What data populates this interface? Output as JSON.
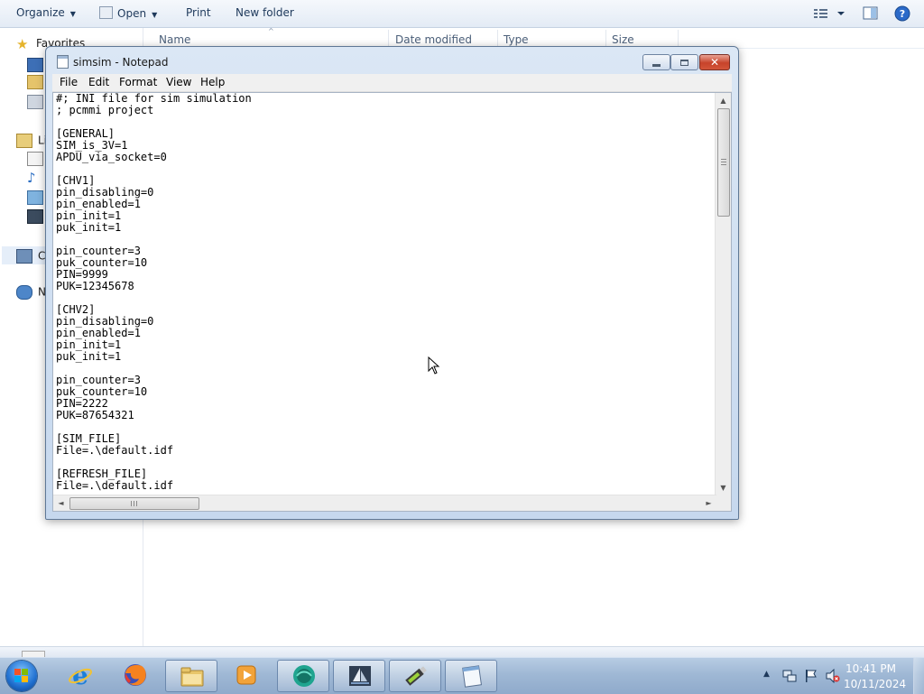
{
  "explorer": {
    "toolbar": {
      "organize_label": "Organize",
      "open_label": "Open",
      "print_label": "Print",
      "new_folder_label": "New folder"
    },
    "nav": {
      "favorites_label": "Favorites",
      "libraries_label": "Li",
      "computer_label": "C",
      "network_label": "N"
    },
    "columns": {
      "name": "Name",
      "date_modified": "Date modified",
      "type": "Type",
      "size": "Size"
    }
  },
  "notepad": {
    "title": "simsim - Notepad",
    "menu": {
      "file": "File",
      "edit": "Edit",
      "format": "Format",
      "view": "View",
      "help": "Help"
    },
    "content": "#; INI file for sim simulation\n; pcmmi project\n\n[GENERAL]\nSIM_is_3V=1\nAPDU_via_socket=0\n\n[CHV1]\npin_disabling=0\npin_enabled=1\npin_init=1\npuk_init=1\n\npin_counter=3\npuk_counter=10\nPIN=9999\nPUK=12345678\n\n[CHV2]\npin_disabling=0\npin_enabled=1\npin_init=1\npuk_init=1\n\npin_counter=3\npuk_counter=10\nPIN=2222\nPUK=87654321\n\n[SIM_FILE]\nFile=.\\default.idf\n\n[REFRESH_FILE]\nFile=.\\default.idf"
  },
  "taskbar": {
    "pinned": [
      "start-orb",
      "internet-explorer",
      "firefox",
      "windows-explorer",
      "media-player",
      "app-green-globe",
      "app-sailboat",
      "app-usb-stick",
      "notepad"
    ],
    "clock": {
      "time": "10:41 PM",
      "date": "10/11/2024"
    }
  },
  "colors": {
    "taskbar": "#9fb8d5",
    "window_frame": "#c6d8ee",
    "close_button": "#c7432a",
    "explorer_toolbar": "#e3ebf5"
  }
}
